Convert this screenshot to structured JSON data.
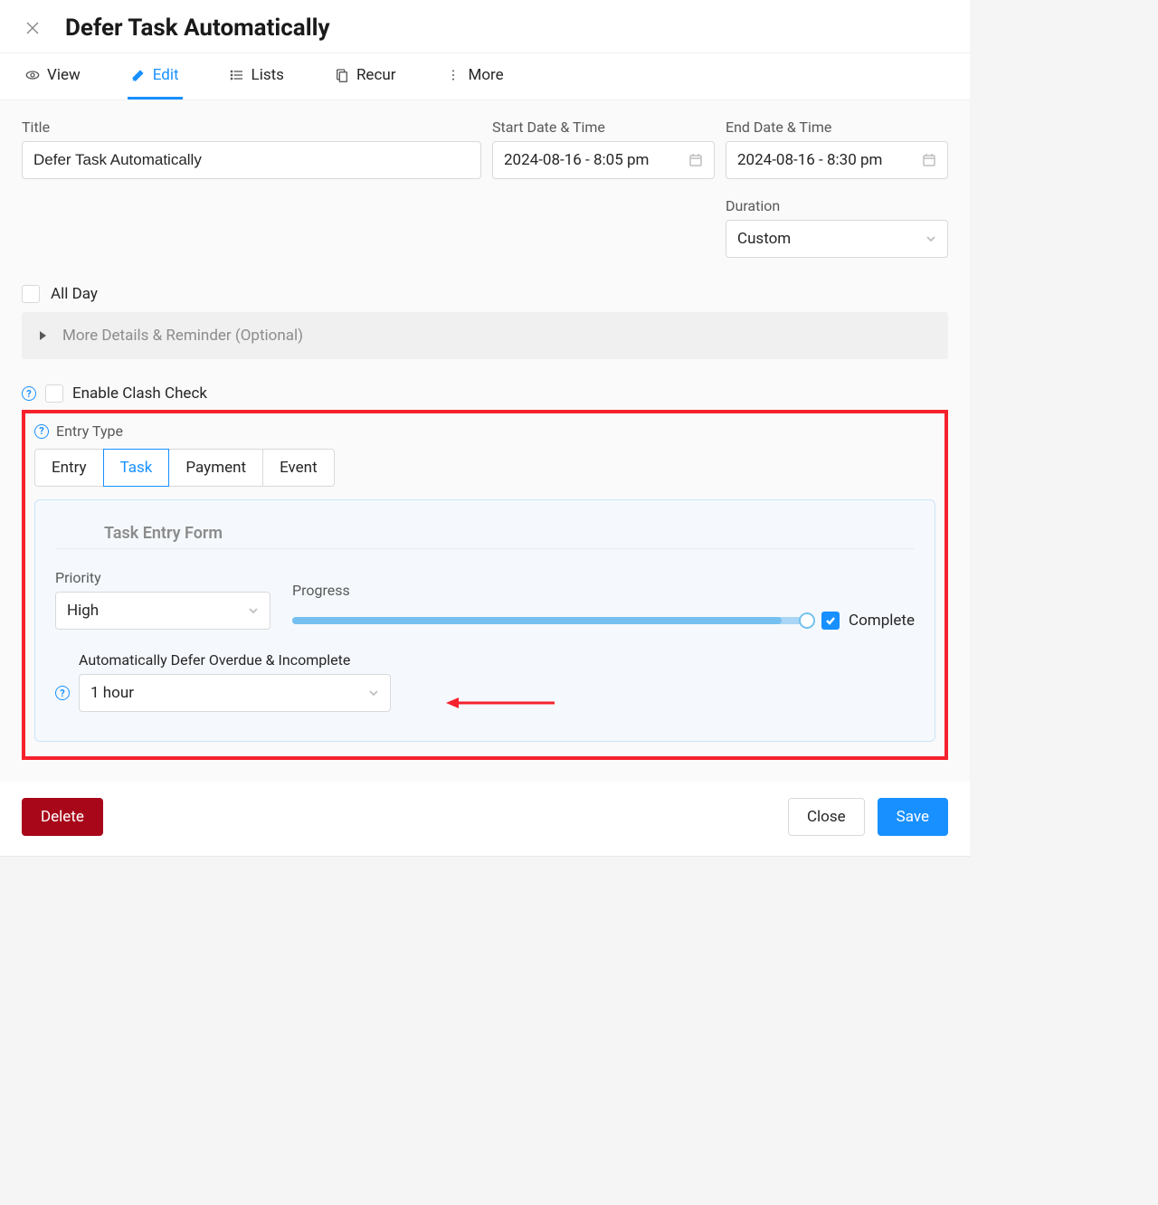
{
  "header": {
    "title": "Defer Task Automatically"
  },
  "tabs": {
    "view": "View",
    "edit": "Edit",
    "lists": "Lists",
    "recur": "Recur",
    "more": "More"
  },
  "form": {
    "title_label": "Title",
    "title_value": "Defer Task Automatically",
    "start_label": "Start Date & Time",
    "start_value": "2024-08-16 - 8:05 pm",
    "end_label": "End Date & Time",
    "end_value": "2024-08-16 - 8:30 pm",
    "duration_label": "Duration",
    "duration_value": "Custom",
    "all_day_label": "All Day",
    "more_details_label": "More Details & Reminder (Optional)",
    "clash_label": "Enable Clash Check",
    "entry_type_label": "Entry Type",
    "entry_types": {
      "entry": "Entry",
      "task": "Task",
      "payment": "Payment",
      "event": "Event"
    },
    "task_form": {
      "legend": "Task Entry Form",
      "priority_label": "Priority",
      "priority_value": "High",
      "progress_label": "Progress",
      "complete_label": "Complete",
      "complete_checked": true,
      "defer_label": "Automatically Defer Overdue & Incomplete",
      "defer_value": "1 hour"
    }
  },
  "footer": {
    "delete": "Delete",
    "close": "Close",
    "save": "Save"
  }
}
